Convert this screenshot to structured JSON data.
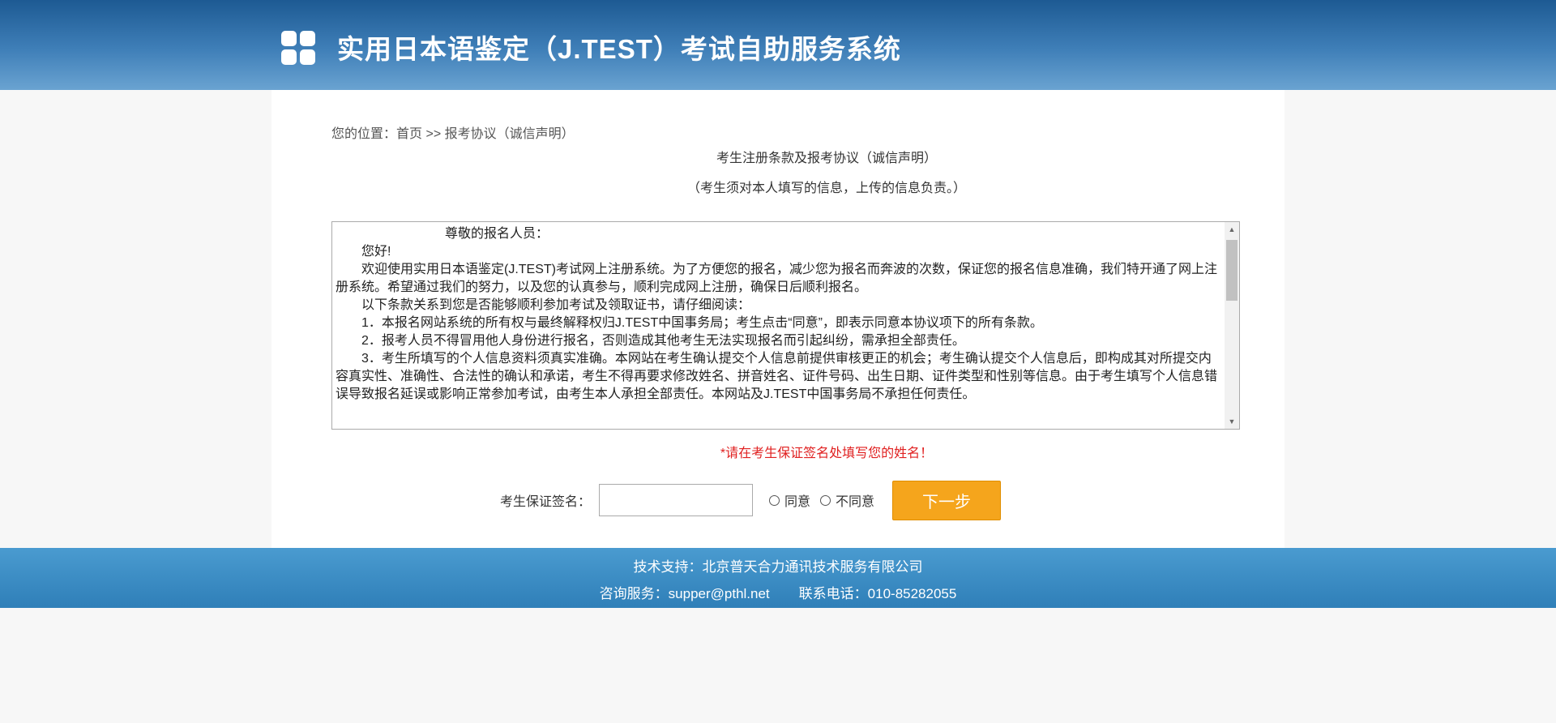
{
  "header": {
    "title": "实用日本语鉴定（J.TEST）考试自助服务系统"
  },
  "breadcrumb": {
    "prefix": "您的位置：",
    "home": "首页",
    "sep": " >> ",
    "current": "报考协议（诚信声明）"
  },
  "agreement": {
    "title": "考生注册条款及报考协议（诚信声明）",
    "subtitle": "（考生须对本人填写的信息，上传的信息负责。）",
    "paragraphs": [
      "尊敬的报名人员：",
      "您好!",
      "欢迎使用实用日本语鉴定(J.TEST)考试网上注册系统。为了方便您的报名，减少您为报名而奔波的次数，保证您的报名信息准确，我们特开通了网上注册系统。希望通过我们的努力，以及您的认真参与，顺利完成网上注册，确保日后顺利报名。",
      "以下条款关系到您是否能够顺利参加考试及领取证书，请仔细阅读：",
      "1．本报名网站系统的所有权与最终解释权归J.TEST中国事务局；考生点击“同意”，即表示同意本协议项下的所有条款。",
      "2．报考人员不得冒用他人身份进行报名，否则造成其他考生无法实现报名而引起纠纷，需承担全部责任。",
      "3．考生所填写的个人信息资料须真实准确。本网站在考生确认提交个人信息前提供审核更正的机会；考生确认提交个人信息后，即构成其对所提交内容真实性、准确性、合法性的确认和承诺，考生不得再要求修改姓名、拼音姓名、证件号码、出生日期、证件类型和性别等信息。由于考生填写个人信息错误导致报名延误或影响正常参加考试，由考生本人承担全部责任。本网站及J.TEST中国事务局不承担任何责任。"
    ]
  },
  "notice": "*请在考生保证签名处填写您的姓名！",
  "form": {
    "sign_label": "考生保证签名：",
    "sign_value": "",
    "agree": "同意",
    "disagree": "不同意",
    "next": "下一步"
  },
  "footer": {
    "support": "技术支持：北京普天合力通讯技术服务有限公司",
    "service": "咨询服务：supper@pthl.net",
    "phone": "联系电话：010-85282055"
  }
}
